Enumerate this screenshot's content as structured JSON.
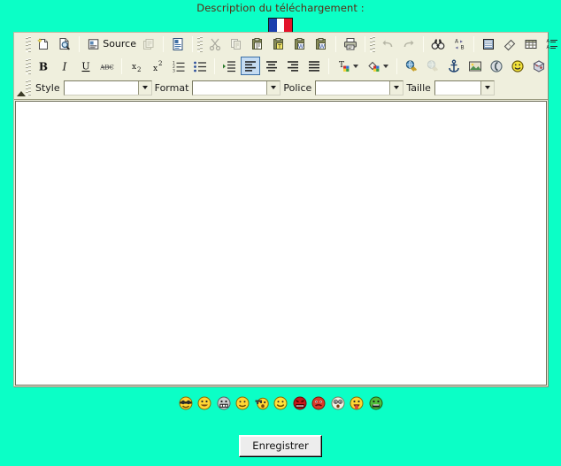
{
  "page": {
    "title": "Description du téléchargement :",
    "background_color": "#0BFFC6",
    "title_color": "#5A2A12"
  },
  "flag": {
    "name": "french-flag",
    "stripes": [
      "#1b3fae",
      "#ffffff",
      "#e3132b"
    ]
  },
  "editor": {
    "background_color": "#EFEFDD",
    "canvas_color": "#FFFFFF",
    "canvas_content": "",
    "active_button_color": "#C5DCF2",
    "toolbar_rows": [
      {
        "name": "row-1",
        "groups": [
          {
            "items": [
              {
                "name": "new-page-button",
                "icon": "new-page-icon",
                "label": "",
                "state": "enabled"
              },
              {
                "name": "preview-button",
                "icon": "preview-icon",
                "label": "",
                "state": "enabled"
              }
            ]
          },
          {
            "items": [
              {
                "name": "source-button",
                "icon": "source-icon",
                "label": "Source",
                "state": "enabled"
              },
              {
                "name": "templates-button",
                "icon": "templates-icon",
                "label": "",
                "state": "disabled"
              }
            ]
          },
          {
            "items": [
              {
                "name": "document-properties-button",
                "icon": "document-properties-icon",
                "label": "",
                "state": "enabled"
              }
            ]
          },
          {
            "items": [
              {
                "name": "cut-button",
                "icon": "scissors-icon",
                "label": "",
                "state": "disabled"
              },
              {
                "name": "copy-button",
                "icon": "copy-icon",
                "label": "",
                "state": "disabled"
              },
              {
                "name": "paste-button",
                "icon": "paste-icon",
                "label": "",
                "state": "enabled"
              },
              {
                "name": "paste-text-button",
                "icon": "paste-text-icon",
                "label": "",
                "state": "enabled"
              },
              {
                "name": "paste-word-button",
                "icon": "paste-word-icon",
                "label": "",
                "state": "enabled"
              },
              {
                "name": "paste-from-word-button",
                "icon": "paste-from-word-icon",
                "label": "",
                "state": "enabled"
              }
            ]
          },
          {
            "items": [
              {
                "name": "print-button",
                "icon": "printer-icon",
                "label": "",
                "state": "enabled"
              }
            ]
          },
          {
            "items": [
              {
                "name": "undo-button",
                "icon": "undo-icon",
                "label": "",
                "state": "disabled"
              },
              {
                "name": "redo-button",
                "icon": "redo-icon",
                "label": "",
                "state": "disabled"
              }
            ]
          },
          {
            "items": [
              {
                "name": "find-button",
                "icon": "binoculars-icon",
                "label": "",
                "state": "enabled"
              },
              {
                "name": "replace-button",
                "icon": "replace-ab-icon",
                "label": "",
                "state": "enabled"
              }
            ]
          },
          {
            "items": [
              {
                "name": "select-all-button",
                "icon": "select-all-icon",
                "label": "",
                "state": "enabled"
              },
              {
                "name": "remove-format-button",
                "icon": "eraser-icon",
                "label": "",
                "state": "enabled"
              },
              {
                "name": "table-button",
                "icon": "table-icon",
                "label": "",
                "state": "enabled"
              },
              {
                "name": "definition-list-button",
                "icon": "definition-list-icon",
                "label": "",
                "state": "enabled"
              },
              {
                "name": "help-button",
                "icon": "question-mark-icon",
                "label": "",
                "state": "enabled"
              }
            ]
          }
        ]
      },
      {
        "name": "row-2",
        "groups": [
          {
            "items": [
              {
                "name": "bold-button",
                "icon": "bold-icon",
                "label": "B",
                "state": "enabled"
              },
              {
                "name": "italic-button",
                "icon": "italic-icon",
                "label": "I",
                "state": "enabled"
              },
              {
                "name": "underline-button",
                "icon": "underline-icon",
                "label": "U",
                "state": "enabled"
              },
              {
                "name": "strikethrough-button",
                "icon": "strikethrough-icon",
                "label": "ABC",
                "state": "enabled"
              }
            ]
          },
          {
            "items": [
              {
                "name": "subscript-button",
                "icon": "subscript-icon",
                "label": "x2",
                "state": "enabled"
              },
              {
                "name": "superscript-button",
                "icon": "superscript-icon",
                "label": "x2",
                "state": "enabled"
              },
              {
                "name": "numbered-list-button",
                "icon": "numbered-list-icon",
                "label": "",
                "state": "enabled"
              },
              {
                "name": "bulleted-list-button",
                "icon": "bulleted-list-icon",
                "label": "",
                "state": "enabled"
              }
            ]
          },
          {
            "items": [
              {
                "name": "indent-button",
                "icon": "indent-icon",
                "label": "",
                "state": "enabled"
              },
              {
                "name": "align-left-button",
                "icon": "align-left-icon",
                "label": "",
                "state": "active"
              },
              {
                "name": "align-center-button",
                "icon": "align-center-icon",
                "label": "",
                "state": "enabled"
              },
              {
                "name": "align-right-button",
                "icon": "align-right-icon",
                "label": "",
                "state": "enabled"
              },
              {
                "name": "align-justify-button",
                "icon": "align-justify-icon",
                "label": "",
                "state": "enabled"
              }
            ]
          },
          {
            "items": [
              {
                "name": "text-color-button",
                "icon": "text-color-icon",
                "label": "",
                "state": "enabled",
                "has_caret": true
              },
              {
                "name": "background-color-button",
                "icon": "background-color-icon",
                "label": "",
                "state": "enabled",
                "has_caret": true
              }
            ]
          },
          {
            "items": [
              {
                "name": "link-button",
                "icon": "link-globe-icon",
                "label": "",
                "state": "enabled"
              },
              {
                "name": "unlink-button",
                "icon": "unlink-globe-icon",
                "label": "",
                "state": "disabled"
              },
              {
                "name": "anchor-button",
                "icon": "anchor-icon",
                "label": "",
                "state": "enabled"
              },
              {
                "name": "image-button",
                "icon": "image-icon",
                "label": "",
                "state": "enabled"
              },
              {
                "name": "flash-button",
                "icon": "flash-icon",
                "label": "",
                "state": "enabled"
              },
              {
                "name": "smiley-button",
                "icon": "smiley-icon",
                "label": "",
                "state": "enabled"
              },
              {
                "name": "special-char-button",
                "icon": "special-char-icon",
                "label": "",
                "state": "enabled"
              }
            ]
          }
        ]
      }
    ],
    "field_row": {
      "name": "row-3",
      "fields": [
        {
          "name": "style-select",
          "label": "Style",
          "value": "",
          "placeholder": ""
        },
        {
          "name": "format-select",
          "label": "Format",
          "value": "",
          "placeholder": ""
        },
        {
          "name": "police-select",
          "label": "Police",
          "value": "",
          "placeholder": ""
        },
        {
          "name": "taille-select",
          "label": "Taille",
          "value": "",
          "placeholder": ""
        }
      ]
    }
  },
  "smileys": [
    {
      "name": "smiley-cool",
      "face": "#FFD634",
      "variant": "sunglasses"
    },
    {
      "name": "smiley-grin",
      "face": "#FFD634",
      "variant": "grin"
    },
    {
      "name": "smiley-teeth",
      "face": "#C9CDCE",
      "variant": "teeth"
    },
    {
      "name": "smiley-smile",
      "face": "#FFD634",
      "variant": "smile"
    },
    {
      "name": "smiley-gun",
      "face": "#FFD634",
      "variant": "gun"
    },
    {
      "name": "smiley-happy",
      "face": "#FFE13A",
      "variant": "happy"
    },
    {
      "name": "smiley-angry",
      "face": "#C41A1A",
      "variant": "angry"
    },
    {
      "name": "smiley-mad",
      "face": "#D93B2B",
      "variant": "mad"
    },
    {
      "name": "smiley-surprised",
      "face": "#F3EFE2",
      "variant": "surprised"
    },
    {
      "name": "smiley-tongue",
      "face": "#FFD634",
      "variant": "tongue"
    },
    {
      "name": "smiley-sick",
      "face": "#4FBF3A",
      "variant": "sick"
    }
  ],
  "actions": {
    "save_label": "Enregistrer"
  }
}
